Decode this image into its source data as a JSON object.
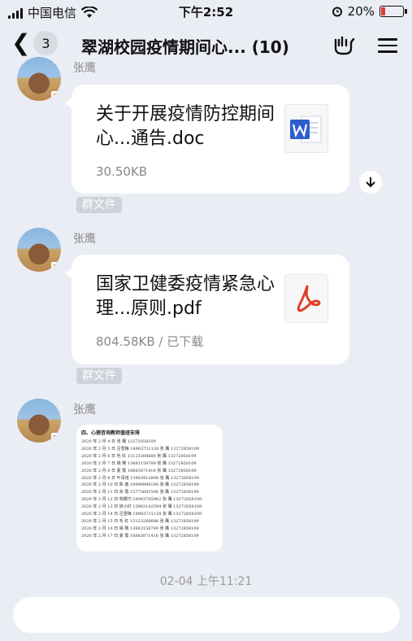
{
  "status_bar": {
    "carrier": "中国电信",
    "time": "下午2:52",
    "battery": "20%",
    "battery_level": 0.2
  },
  "header": {
    "unread_count": "3",
    "title": "翠湖校园疫情期间心... (10)"
  },
  "messages": [
    {
      "sender": "张鹰",
      "file_name": "关于开展疫情防控期间心...通告.doc",
      "file_meta": "30.50KB",
      "tag": "群文件",
      "icon": "word-file-icon"
    },
    {
      "sender": "张鹰",
      "file_name": "国家卫健委疫情紧急心理...原则.pdf",
      "file_meta": "804.58KB / 已下载",
      "tag": "群文件",
      "icon": "pdf-file-icon"
    },
    {
      "sender": "张鹰",
      "image": {
        "title": "四、心理咨询教师值班安排",
        "rows": [
          "2020 年 2 月 4 日    张  鹰  13272858109",
          "2020 年 2 月 5 日    吕雪梅 18983731128   张  鹰  13272858109",
          "2020 年 2 月 6 日    毛  红  15123268688   张  鹰  13272858109",
          "2020 年 2 月 7 日    姚  略  13883158789   张  鹰  13272858109",
          "2020 年 2 月 8 日    夏  霞  18883871416   张  鹰  13272858109",
          "2020 年 2 月 9 日    叶泽培 13883912808   张  鹰  13272858109",
          "2020 年 2 月 10 日   陈  茜  18996896188   张  鹰  13272858109",
          "2020 年 2 月 11 日   余  霞  15775691506   张  鹰  13272858109",
          "2020 年 2 月 12 日   苟娜巧 18983765962   张  鹰  13272858109",
          "2020 年 2 月 13 日   徐小红 13883142594   张  鹰  13272858109",
          "2020 年 2 月 14 日   吕雪梅 18983731128   张  鹰  13272858109",
          "2020 年 2 月 15 日   毛  红  15123268688   张  鹰  13272858109",
          "2020 年 2 月 16 日   姚  略  13883158789   张  鹰  13272858109",
          "2020 年 2 月 17 日   夏  霞  18883871416   张  鹰  13272858109"
        ]
      }
    }
  ],
  "timestamp": "02-04 上午11:21",
  "colors": {
    "background": "#ebedf5",
    "word_blue": "#2b5fce",
    "pdf_red": "#e0402a",
    "battery_red": "#e53935"
  }
}
